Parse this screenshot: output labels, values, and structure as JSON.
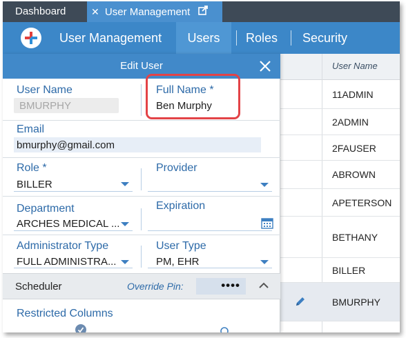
{
  "tabs": {
    "dashboard": "Dashboard",
    "user_management": "User Management",
    "close_glyph": "✕"
  },
  "nav": {
    "user_management": "User Management",
    "users": "Users",
    "roles": "Roles",
    "security": "Security"
  },
  "panel": {
    "title": "Edit User",
    "user_name": {
      "label": "User Name",
      "value": "BMURPHY"
    },
    "full_name": {
      "label": "Full Name *",
      "value": "Ben Murphy"
    },
    "email": {
      "label": "Email",
      "value": "bmurphy@gmail.com"
    },
    "role": {
      "label": "Role *",
      "value": "BILLER"
    },
    "provider": {
      "label": "Provider",
      "value": ""
    },
    "department": {
      "label": "Department",
      "value": "ARCHES MEDICAL ..."
    },
    "expiration": {
      "label": "Expiration",
      "value": ""
    },
    "administrator_type": {
      "label": "Administrator Type",
      "value": "FULL ADMINISTRA..."
    },
    "user_type": {
      "label": "User Type",
      "value": "PM, EHR"
    },
    "scheduler": {
      "label": "Scheduler",
      "override_pin_label": "Override Pin:",
      "override_pin_value": "••••"
    },
    "restricted_columns": {
      "label": "Restricted Columns"
    }
  },
  "grid": {
    "header": "User Name",
    "rows": [
      "11ADMIN",
      "2ADMIN",
      "2FAUSER",
      "ABROWN",
      "APETERSON",
      "BETHANY",
      "BILLER",
      "BMURPHY"
    ],
    "selected_row": "BMURPHY"
  },
  "colors": {
    "tab_bar": "#3e4a57",
    "nav_bar": "#3c87c8",
    "panel_header": "#4189c9",
    "label_blue": "#2d6aa8",
    "highlight_red": "#e34347"
  }
}
